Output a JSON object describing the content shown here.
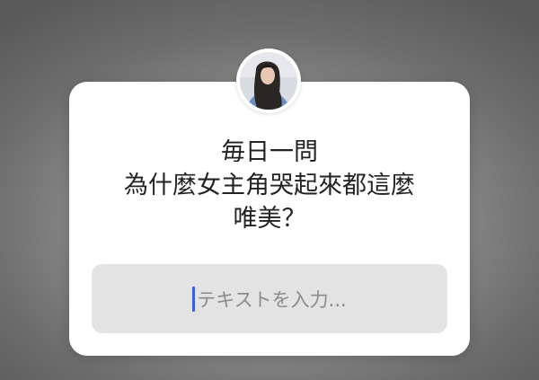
{
  "question_sticker": {
    "title": "毎日一問",
    "lines": [
      "為什麼女主角哭起來都這麼",
      "唯美？"
    ]
  },
  "answer": {
    "placeholder": "テキストを入力...",
    "value": ""
  },
  "avatar": {
    "icon": "profile-photo-avatar"
  },
  "colors": {
    "background": "#8f8f8f",
    "card": "#ffffff",
    "field": "#e3e3e3",
    "caret": "#3a5fe0",
    "text": "#222222",
    "placeholder": "#8b8b8b"
  }
}
